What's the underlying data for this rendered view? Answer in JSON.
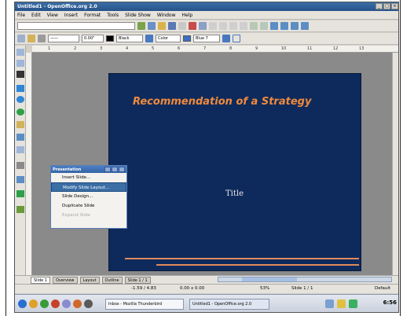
{
  "window": {
    "title": "Untitled1 - OpenOffice.org 2.0"
  },
  "menubar": {
    "items": [
      "File",
      "Edit",
      "View",
      "Insert",
      "Format",
      "Tools",
      "Slide Show",
      "Window",
      "Help"
    ]
  },
  "toolbar2": {
    "line_width": "0.00\"",
    "color_name": "Black",
    "area_style": "Color",
    "area_color": "Blue 7"
  },
  "ruler": {
    "ticks": [
      "1",
      "2",
      "3",
      "4",
      "5",
      "6",
      "7",
      "8",
      "9",
      "10",
      "11",
      "12",
      "13"
    ]
  },
  "slide": {
    "title": "Recommendation of a Strategy",
    "subtitle": "Title"
  },
  "context_panel": {
    "title": "Presentation",
    "items": [
      {
        "label": "Insert Slide...",
        "state": "normal"
      },
      {
        "label": "Modify Slide Layout...",
        "state": "selected"
      },
      {
        "label": "Slide Design...",
        "state": "normal"
      },
      {
        "label": "Duplicate Slide",
        "state": "normal"
      },
      {
        "label": "Expand Slide",
        "state": "disabled"
      }
    ]
  },
  "tabs": {
    "items": [
      "Slide 1",
      "Overview",
      "Layout",
      "Outline",
      "Slide 1 / 1"
    ]
  },
  "statusbar": {
    "position": "-1.59 / 4.83",
    "size": "0.00 x 0.00",
    "zoom": "53%",
    "slide": "Slide 1 / 1",
    "layout": "Default"
  },
  "taskbar": {
    "task1": "Untitled1 - OpenOffice.org 2.0",
    "task2": "Inbox - Mozilla Thunderbird",
    "clock": "6:56"
  },
  "colors": {
    "slide_bg": "#0e2a5c",
    "slide_title": "#f08a3c",
    "slide_lines": "#e08a5c",
    "titlebar": "#3a6ea5"
  }
}
